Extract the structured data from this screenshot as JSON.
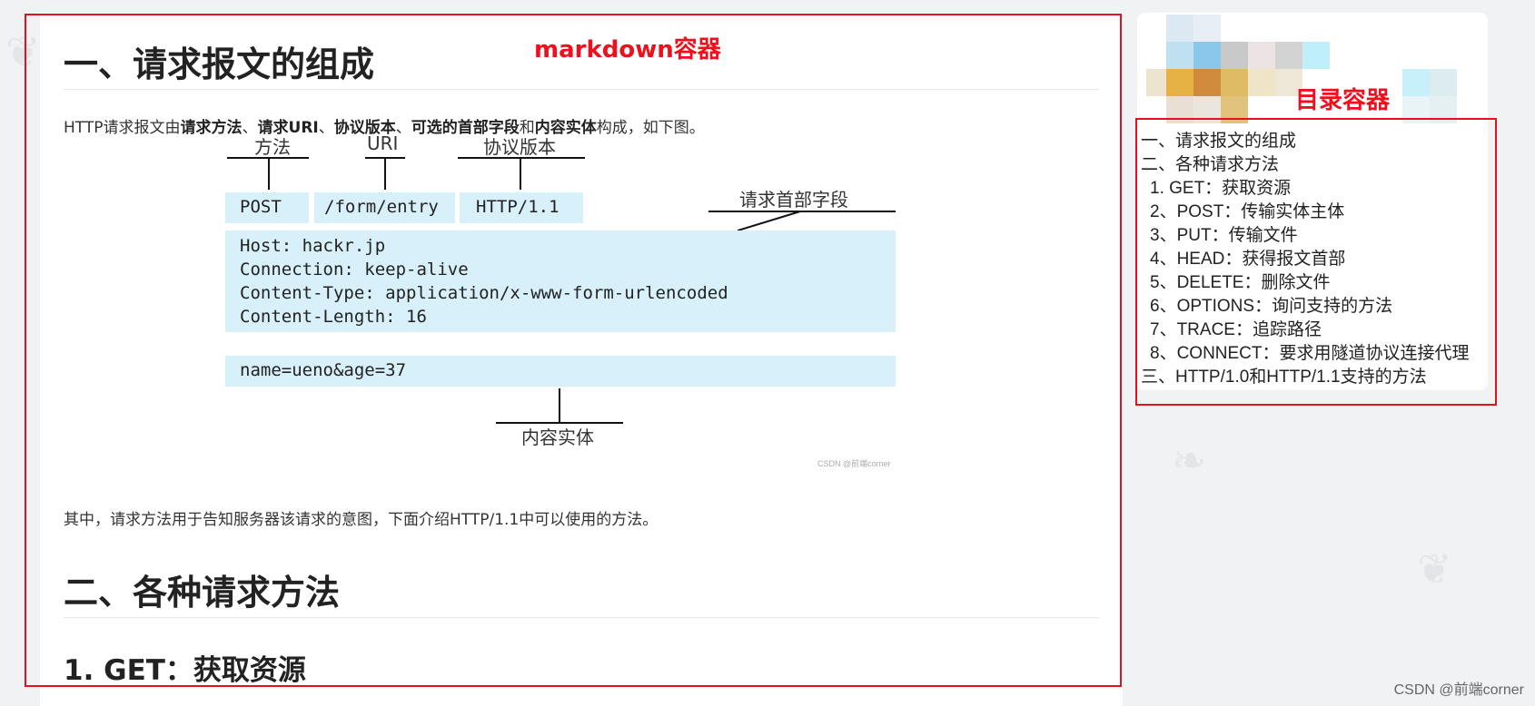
{
  "annotations": {
    "markdown_container": "markdown容器",
    "toc_container": "目录容器"
  },
  "article": {
    "heading1": "一、请求报文的组成",
    "intro": {
      "p1": "HTTP请求报文由",
      "b1": "请求方法",
      "s1": "、",
      "b2": "请求URI",
      "s2": "、",
      "b3": "协议版本",
      "s3": "、",
      "b4": "可选的首部字段",
      "s4": "和",
      "b5": "内容实体",
      "p2": "构成，如下图。"
    },
    "diagram": {
      "label_method": "方法",
      "label_uri": "URI",
      "label_version": "协议版本",
      "label_headers": "请求首部字段",
      "label_body": "内容实体",
      "method": "POST",
      "uri": "/form/entry",
      "version": "HTTP/1.1",
      "headers": [
        "Host: hackr.jp",
        "Connection: keep-alive",
        "Content-Type: application/x-www-form-urlencoded",
        "Content-Length: 16"
      ],
      "body": "name=ueno&age=37",
      "watermark": "CSDN @前端corner"
    },
    "paragraph2": "其中，请求方法用于告知服务器该请求的意图，下面介绍HTTP/1.1中可以使用的方法。",
    "heading2": "二、各种请求方法",
    "heading3": "1. GET：获取资源"
  },
  "toc": {
    "items": [
      "一、请求报文的组成",
      "二、各种请求方法",
      "1. GET：获取资源",
      "2、POST：传输实体主体",
      "3、PUT：传输文件",
      "4、HEAD：获得报文首部",
      "5、DELETE：删除文件",
      "6、OPTIONS：询问支持的方法",
      "7、TRACE：追踪路径",
      "8、CONNECT：要求用隧道协议连接代理",
      "三、HTTP/1.0和HTTP/1.1支持的方法"
    ]
  },
  "credit": "CSDN @前端corner",
  "colors": {
    "annotation_red": "#e5101f",
    "diagram_box": "#d8f0fa",
    "page_bg": "#f1f2f4"
  }
}
